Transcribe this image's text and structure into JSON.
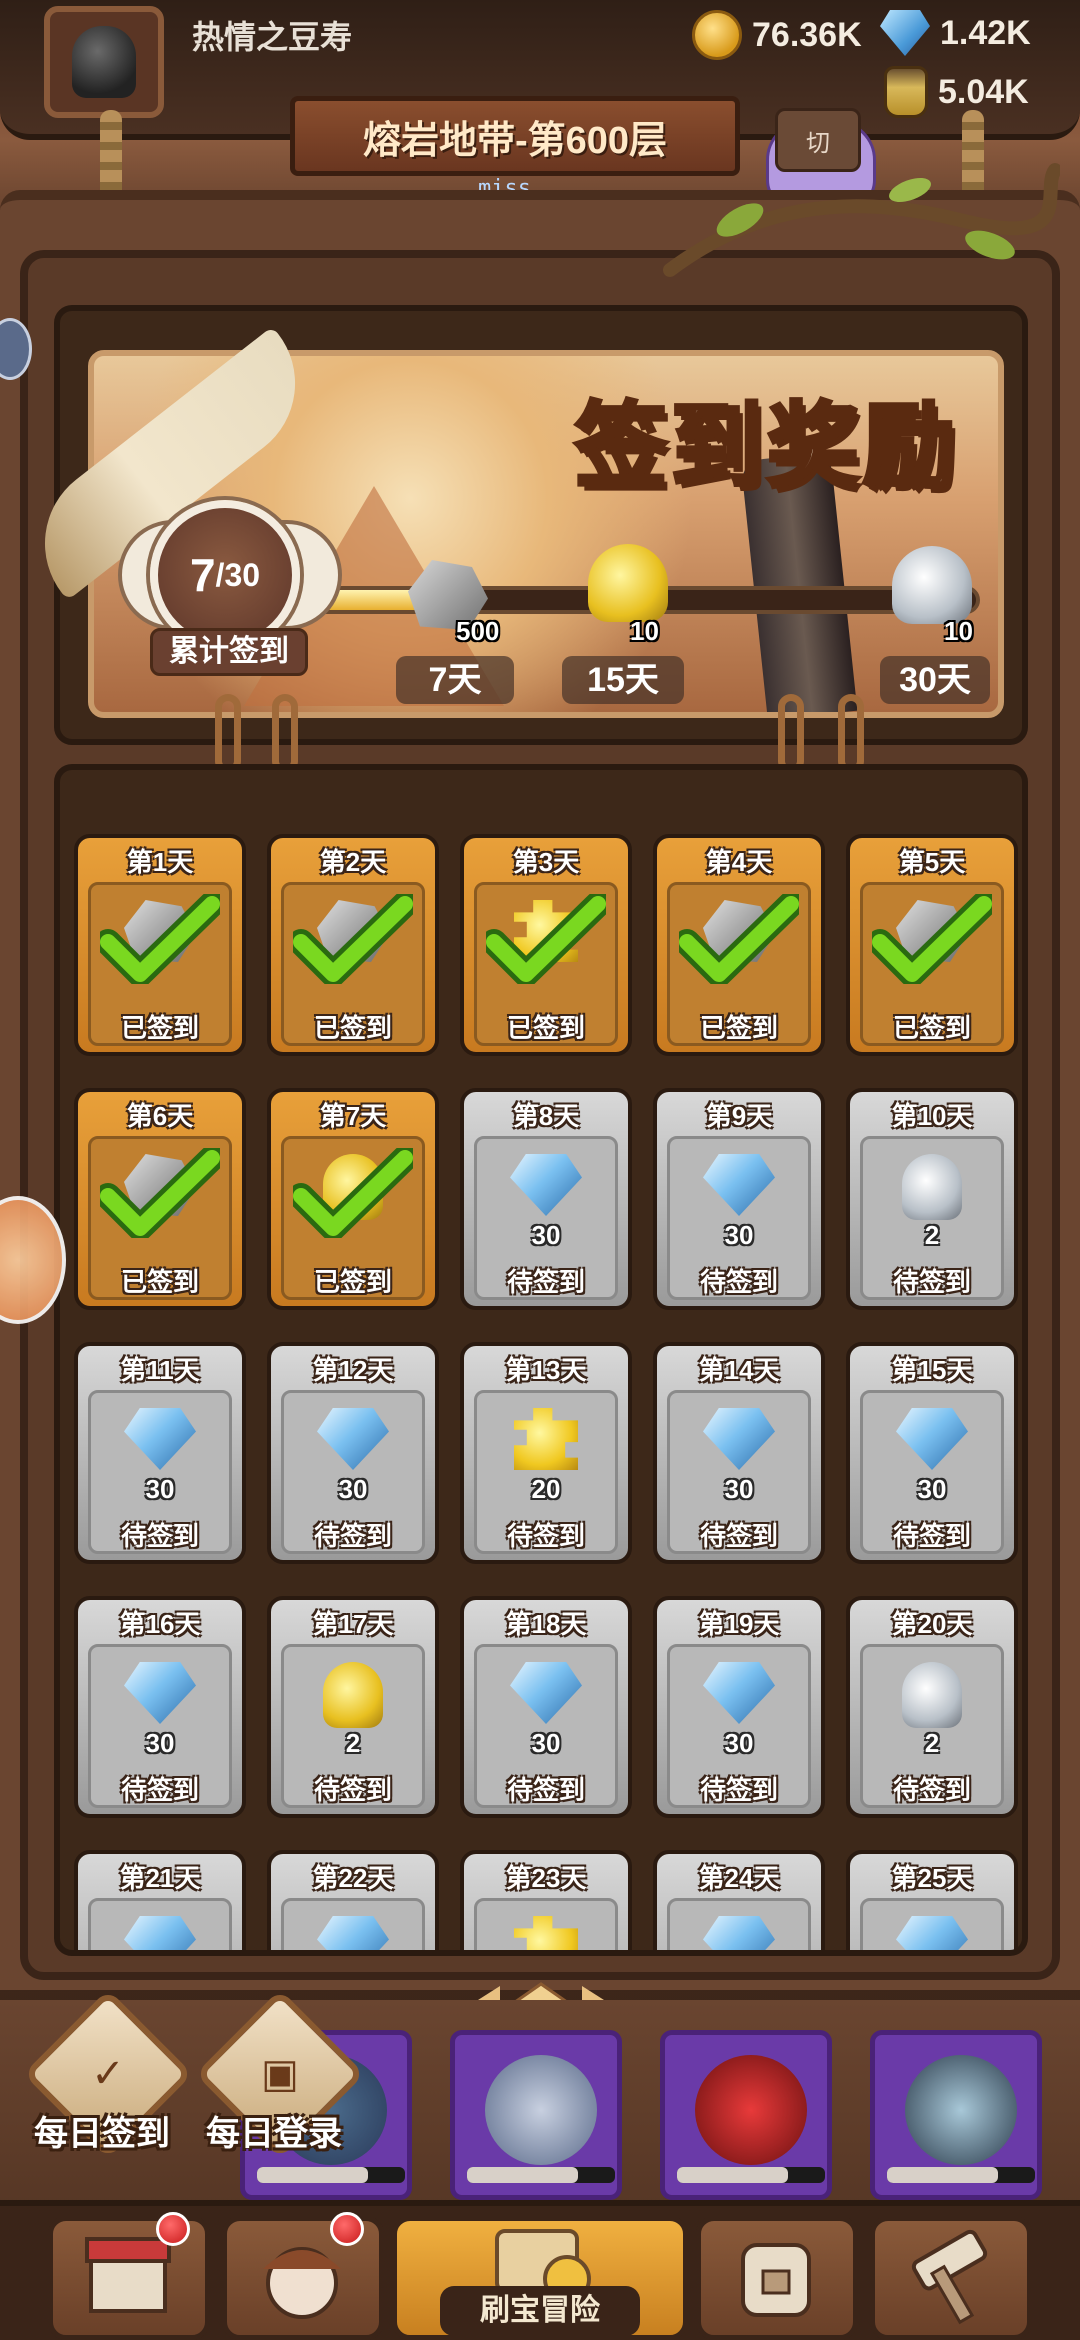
{
  "player": {
    "name": "热情之豆寿"
  },
  "currencies": {
    "coins": "76.36K",
    "gems": "1.42K",
    "jar": "5.04K"
  },
  "level_banner": "熔岩地带-第600层",
  "switch_label": "切",
  "miss_text": "miss",
  "signin": {
    "title": "签到奖励",
    "progress": {
      "current": "7",
      "total": "/30",
      "label": "累计签到",
      "fraction": 0.233
    },
    "milestones": [
      {
        "day_label": "7天",
        "qty": "500",
        "icon": "rock-icon"
      },
      {
        "day_label": "15天",
        "qty": "10",
        "icon": "gold-scroll-icon"
      },
      {
        "day_label": "30天",
        "qty": "10",
        "icon": "silver-scroll-icon"
      }
    ]
  },
  "days": [
    {
      "label": "第1天",
      "status": "已签到",
      "done": true,
      "icon": "rock",
      "qty": ""
    },
    {
      "label": "第2天",
      "status": "已签到",
      "done": true,
      "icon": "rock",
      "qty": ""
    },
    {
      "label": "第3天",
      "status": "已签到",
      "done": true,
      "icon": "puzzle",
      "qty": ""
    },
    {
      "label": "第4天",
      "status": "已签到",
      "done": true,
      "icon": "rock",
      "qty": ""
    },
    {
      "label": "第5天",
      "status": "已签到",
      "done": true,
      "icon": "rock",
      "qty": ""
    },
    {
      "label": "第6天",
      "status": "已签到",
      "done": true,
      "icon": "rock",
      "qty": ""
    },
    {
      "label": "第7天",
      "status": "已签到",
      "done": true,
      "icon": "scroll-gold",
      "qty": ""
    },
    {
      "label": "第8天",
      "status": "待签到",
      "done": false,
      "icon": "gem",
      "qty": "30"
    },
    {
      "label": "第9天",
      "status": "待签到",
      "done": false,
      "icon": "gem",
      "qty": "30"
    },
    {
      "label": "第10天",
      "status": "待签到",
      "done": false,
      "icon": "scroll-silver",
      "qty": "2"
    },
    {
      "label": "第11天",
      "status": "待签到",
      "done": false,
      "icon": "gem",
      "qty": "30"
    },
    {
      "label": "第12天",
      "status": "待签到",
      "done": false,
      "icon": "gem",
      "qty": "30"
    },
    {
      "label": "第13天",
      "status": "待签到",
      "done": false,
      "icon": "puzzle",
      "qty": "20"
    },
    {
      "label": "第14天",
      "status": "待签到",
      "done": false,
      "icon": "gem",
      "qty": "30"
    },
    {
      "label": "第15天",
      "status": "待签到",
      "done": false,
      "icon": "gem",
      "qty": "30"
    },
    {
      "label": "第16天",
      "status": "待签到",
      "done": false,
      "icon": "gem",
      "qty": "30"
    },
    {
      "label": "第17天",
      "status": "待签到",
      "done": false,
      "icon": "scroll-gold",
      "qty": "2"
    },
    {
      "label": "第18天",
      "status": "待签到",
      "done": false,
      "icon": "gem",
      "qty": "30"
    },
    {
      "label": "第19天",
      "status": "待签到",
      "done": false,
      "icon": "gem",
      "qty": "30"
    },
    {
      "label": "第20天",
      "status": "待签到",
      "done": false,
      "icon": "scroll-silver",
      "qty": "2"
    },
    {
      "label": "第21天",
      "status": "",
      "done": false,
      "icon": "gem",
      "qty": ""
    },
    {
      "label": "第22天",
      "status": "",
      "done": false,
      "icon": "gem",
      "qty": ""
    },
    {
      "label": "第23天",
      "status": "",
      "done": false,
      "icon": "puzzle",
      "qty": ""
    },
    {
      "label": "第24天",
      "status": "",
      "done": false,
      "icon": "gem",
      "qty": ""
    },
    {
      "label": "第25天",
      "status": "",
      "done": false,
      "icon": "gem",
      "qty": ""
    }
  ],
  "bottom_actions": {
    "daily_signin": "每日签到",
    "daily_login": "每日登录"
  },
  "nav": {
    "center_label": "刷宝冒险"
  },
  "colors": {
    "done_card": "#e8a03a",
    "pending_card": "#c8c8c8",
    "wood_dark": "#3a2418",
    "check_green": "#7ad820"
  }
}
